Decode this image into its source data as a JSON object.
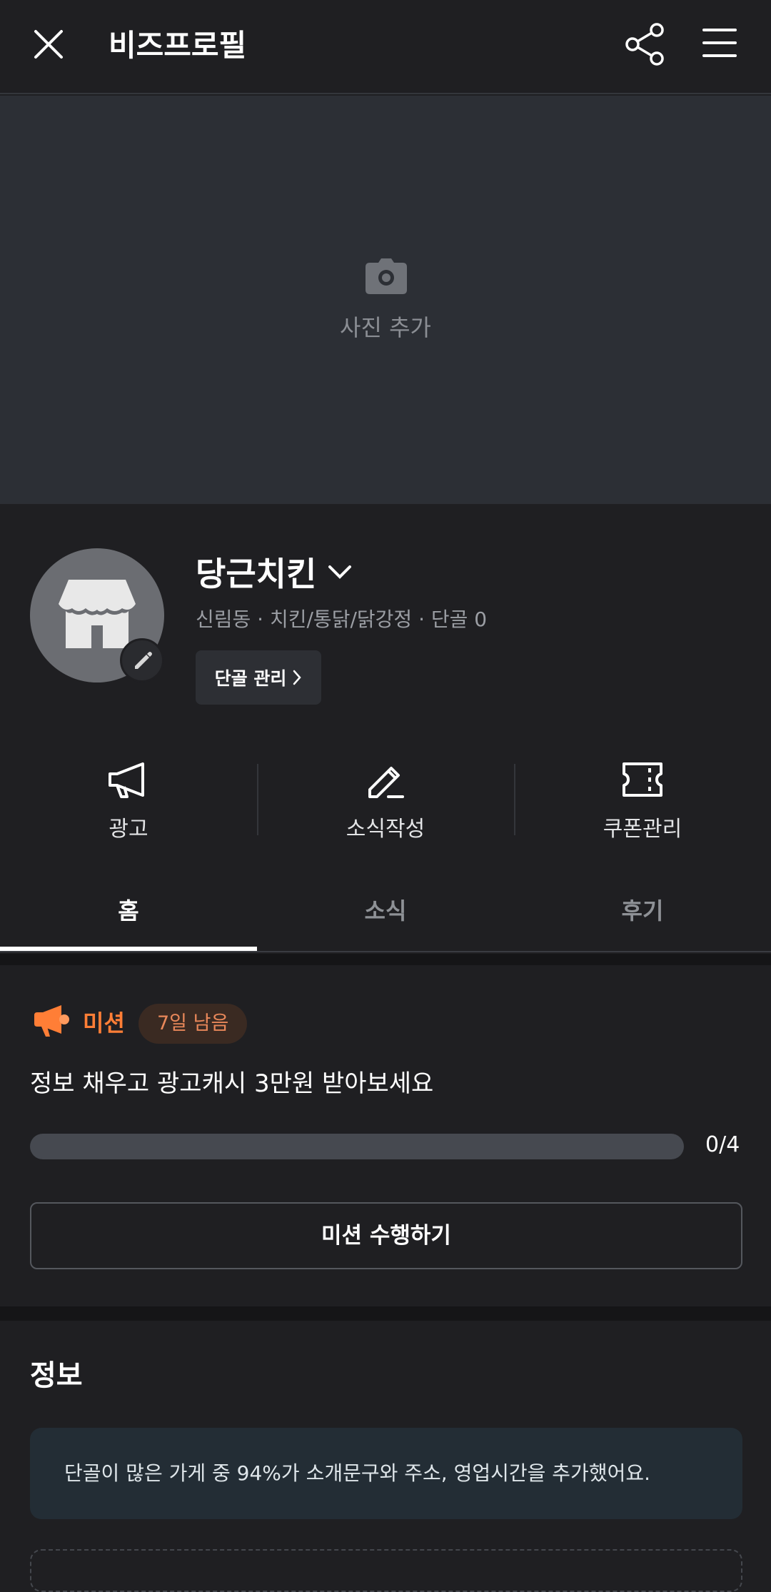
{
  "header": {
    "title": "비즈프로필"
  },
  "cover": {
    "add_photo_label": "사진 추가"
  },
  "profile": {
    "store_name": "당근치킨",
    "meta": "신림동 · 치킨/통닭/닭강정 · 단골 0",
    "regular_button_label": "단골 관리"
  },
  "actions": [
    {
      "label": "광고",
      "icon": "megaphone-icon"
    },
    {
      "label": "소식작성",
      "icon": "pencil-icon"
    },
    {
      "label": "쿠폰관리",
      "icon": "coupon-icon"
    }
  ],
  "tabs": [
    {
      "label": "홈",
      "active": true
    },
    {
      "label": "소식",
      "active": false
    },
    {
      "label": "후기",
      "active": false
    }
  ],
  "mission": {
    "title": "미션",
    "badge": "7일 남음",
    "description": "정보 채우고 광고캐시 3만원 받아보세요",
    "progress_text": "0/4",
    "progress_fraction": 0,
    "button_label": "미션 수행하기",
    "accent_color": "#ff7e36"
  },
  "info": {
    "title": "정보",
    "tip": "단골이 많은 가게 중 94%가 소개문구와 주소, 영업시간을 추가했어요."
  }
}
